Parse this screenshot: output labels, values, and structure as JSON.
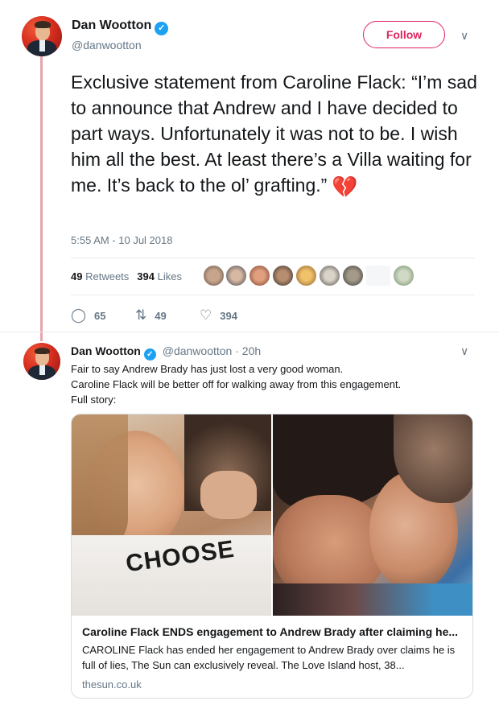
{
  "tweet": {
    "author_name": "Dan Wootton",
    "author_handle": "@danwootton",
    "follow_label": "Follow",
    "text": "Exclusive statement from Caroline Flack: “I’m sad to announce that Andrew and I have decided to part ways. Unfortunately it was not to be. I wish him all the best. At least there’s a Villa waiting for me. It’s back to the ol’ grafting.”",
    "emoji": "💔",
    "timestamp": "5:55 AM - 10 Jul 2018",
    "retweets_count": "49",
    "retweets_label": "Retweets",
    "likes_count": "394",
    "likes_label": "Likes",
    "actions": {
      "reply_count": "65",
      "retweet_count": "49",
      "like_count": "394"
    },
    "icons": {
      "verified": "verified-badge-icon",
      "caret": "chevron-down-icon",
      "reply": "reply-icon",
      "retweet": "retweet-icon",
      "like": "heart-icon",
      "broken_heart": "broken-heart-emoji"
    },
    "colors": {
      "follow_accent": "#e0245e",
      "verified": "#1da1f2",
      "thread_line": "#e8a3ac",
      "muted": "#657786"
    }
  },
  "reply": {
    "author_name": "Dan Wootton",
    "author_handle": "@danwootton",
    "time": "· 20h",
    "lines": [
      "Fair to say Andrew Brady has just lost a very good woman.",
      "Caroline Flack will be better off for walking away from this engagement.",
      "Full story:"
    ],
    "card": {
      "title": "Caroline Flack ENDS engagement to Andrew Brady after claiming he...",
      "description": "CAROLINE Flack has ended her engagement to Andrew Brady over claims he is full of lies, The Sun can exclusively reveal. The Love Island host, 38...",
      "domain": "thesun.co.uk",
      "image_text": "CHOOSE"
    }
  }
}
